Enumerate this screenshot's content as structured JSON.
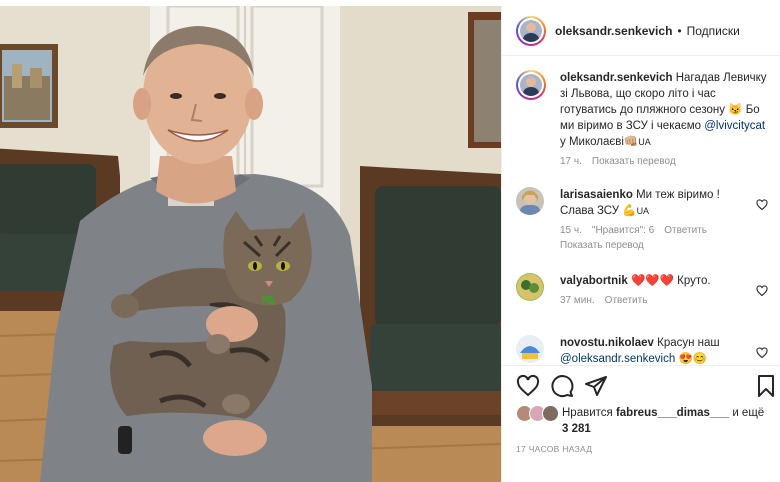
{
  "header": {
    "username": "oleksandr.senkevich",
    "separator": "•",
    "follow_label": "Подписки"
  },
  "caption": {
    "username": "oleksandr.senkevich",
    "text_1": "Нагадав Левичку зі Львова, що скоро літо і час готуватись до пляжного сезону",
    "emoji_1": "😼",
    "text_2": "Бо ми віримо в ЗСУ і чекаємо",
    "mention": "@lvivcitycat",
    "text_3": "у Миколаєві👊🏼",
    "flag": "UA",
    "time": "17 ч.",
    "translate": "Показать перевод"
  },
  "comments": [
    {
      "username": "larisasaienko",
      "text_1": "Ми теж віримо !",
      "text_2": "Слава ЗСУ",
      "emoji": "💪",
      "flag": "UA",
      "time": "15 ч.",
      "likes": "\"Нравится\": 6",
      "reply": "Ответить",
      "translate": "Показать перевод"
    },
    {
      "username": "valyabortnik",
      "hearts": "❤️❤️❤️",
      "text": "Круто.",
      "time": "37 мин.",
      "reply": "Ответить"
    },
    {
      "username": "novostu.nikolaev",
      "text": "Красун наш",
      "mention": "@oleksandr.senkevich",
      "emoji": "😍😊"
    }
  ],
  "actions": {
    "like_icon": "heart-outline-icon",
    "comment_icon": "comment-icon",
    "share_icon": "share-icon",
    "save_icon": "bookmark-icon"
  },
  "likes": {
    "prefix": "Нравится",
    "users": "fabreus___dimas___",
    "and": "и ещё",
    "count": "3 281"
  },
  "post_time": "17 ЧАСОВ НАЗАД",
  "colors": {
    "text": "#262626",
    "secondary": "#8e8e8e",
    "link": "#00376b",
    "heart": "#ed4956",
    "border": "#efefef"
  }
}
